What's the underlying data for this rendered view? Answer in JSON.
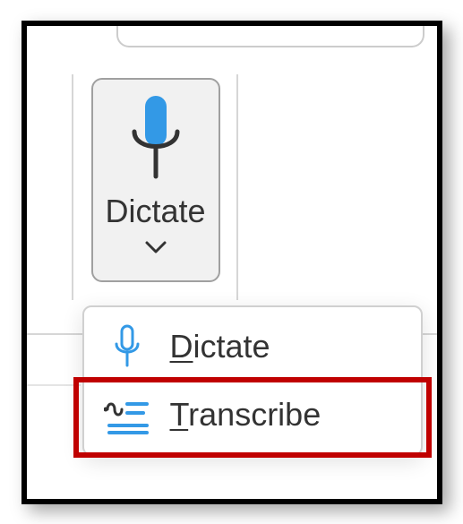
{
  "ribbon": {
    "dictate_button": {
      "label": "Dictate"
    }
  },
  "dropdown": {
    "items": [
      {
        "label_pre": "",
        "label_key": "D",
        "label_post": "ictate",
        "icon": "microphone-icon"
      },
      {
        "label_pre": "",
        "label_key": "T",
        "label_post": "ranscribe",
        "icon": "transcribe-icon"
      }
    ]
  },
  "colors": {
    "accent_blue": "#3399e6",
    "highlight_red": "#c00000"
  }
}
